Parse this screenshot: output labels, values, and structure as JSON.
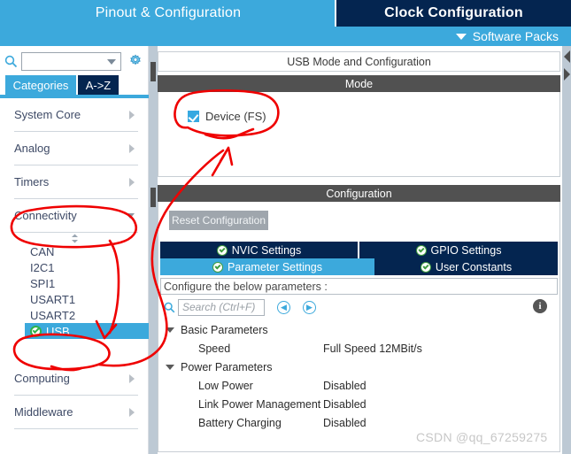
{
  "header": {
    "tab_pinout": "Pinout & Configuration",
    "tab_clock": "Clock Configuration",
    "software_packs": "Software Packs",
    "chevron_icon": "chevron-down-icon"
  },
  "sidebar": {
    "search_icon": "search-icon",
    "search_value": "",
    "search_placeholder": "",
    "gear_icon": "gear-icon",
    "tabs": [
      {
        "label": "Categories",
        "selected": true
      },
      {
        "label": "A->Z",
        "selected": false
      }
    ],
    "categories": [
      {
        "label": "System Core",
        "expanded": false
      },
      {
        "label": "Analog",
        "expanded": false
      },
      {
        "label": "Timers",
        "expanded": false
      },
      {
        "label": "Connectivity",
        "expanded": true
      },
      {
        "label": "Computing",
        "expanded": false
      },
      {
        "label": "Middleware",
        "expanded": false
      }
    ],
    "connectivity_items": [
      {
        "label": "CAN",
        "selected": false,
        "configured": false
      },
      {
        "label": "I2C1",
        "selected": false,
        "configured": false
      },
      {
        "label": "SPI1",
        "selected": false,
        "configured": false
      },
      {
        "label": "USART1",
        "selected": false,
        "configured": false
      },
      {
        "label": "USART2",
        "selected": false,
        "configured": false
      },
      {
        "label": "USB",
        "selected": true,
        "configured": true
      }
    ]
  },
  "main": {
    "title": "USB Mode and Configuration",
    "mode_header": "Mode",
    "mode_options": [
      {
        "label": "Device (FS)",
        "checked": true
      }
    ],
    "configuration_header": "Configuration",
    "reset_button": "Reset Configuration",
    "tabs": [
      {
        "label": "NVIC Settings",
        "active": false
      },
      {
        "label": "GPIO Settings",
        "active": false
      },
      {
        "label": "Parameter Settings",
        "active": true
      },
      {
        "label": "User Constants",
        "active": false
      }
    ],
    "configure_hint": "Configure the below parameters :",
    "search_placeholder": "Search (Ctrl+F)",
    "search_value": "",
    "prev_icon": "chevron-left-circle-icon",
    "next_icon": "chevron-right-circle-icon",
    "info_icon": "info-icon",
    "groups": [
      {
        "name": "Basic Parameters",
        "expanded": true,
        "params": [
          {
            "name": "Speed",
            "value": "Full Speed 12MBit/s"
          }
        ]
      },
      {
        "name": "Power Parameters",
        "expanded": true,
        "params": [
          {
            "name": "Low Power",
            "value": "Disabled"
          },
          {
            "name": "Link Power Management",
            "value": "Disabled"
          },
          {
            "name": "Battery Charging",
            "value": "Disabled"
          }
        ]
      }
    ]
  },
  "watermark": "CSDN @qq_67259275",
  "colors": {
    "accent_cyan": "#3ca9dc",
    "navy": "#042550",
    "band_gray": "#515151",
    "annotation_red": "#ef0000",
    "ok_green": "#2fb34a"
  }
}
